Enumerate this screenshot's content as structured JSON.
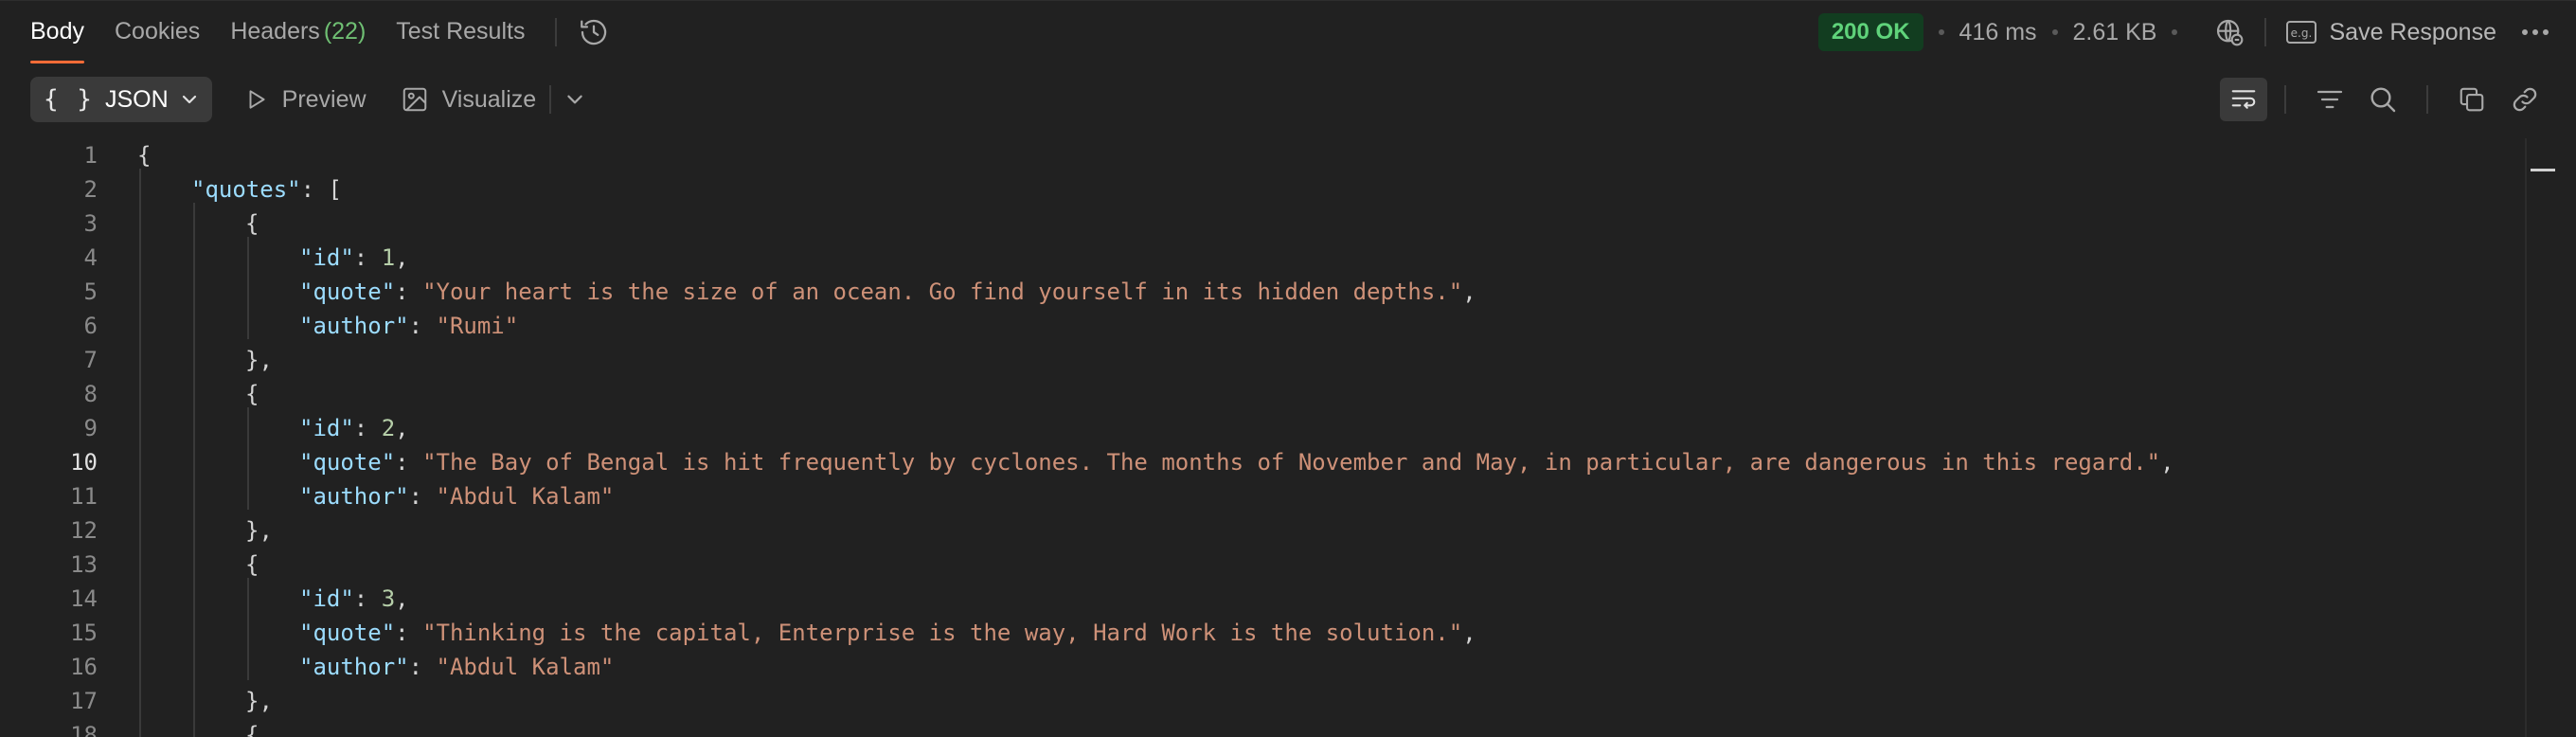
{
  "tabs": [
    {
      "label": "Body",
      "active": true
    },
    {
      "label": "Cookies"
    },
    {
      "label": "Headers",
      "count": "(22)"
    },
    {
      "label": "Test Results"
    }
  ],
  "response": {
    "status": "200 OK",
    "time": "416 ms",
    "size": "2.61 KB",
    "save_label": "Save Response"
  },
  "toolbar": {
    "format_label": "JSON",
    "format_icon": "{ }",
    "preview_label": "Preview",
    "visualize_label": "Visualize"
  },
  "editor": {
    "active_line": 10,
    "lines": [
      [
        [
          "p",
          "{"
        ]
      ],
      [
        [
          "k",
          "\"quotes\""
        ],
        [
          "p",
          ": ["
        ]
      ],
      [
        [
          "p",
          "{"
        ]
      ],
      [
        [
          "k",
          "\"id\""
        ],
        [
          "p",
          ": "
        ],
        [
          "n",
          "1"
        ],
        [
          "p",
          ","
        ]
      ],
      [
        [
          "k",
          "\"quote\""
        ],
        [
          "p",
          ": "
        ],
        [
          "s",
          "\"Your heart is the size of an ocean. Go find yourself in its hidden depths.\""
        ],
        [
          "p",
          ","
        ]
      ],
      [
        [
          "k",
          "\"author\""
        ],
        [
          "p",
          ": "
        ],
        [
          "s",
          "\"Rumi\""
        ]
      ],
      [
        [
          "p",
          "},"
        ]
      ],
      [
        [
          "p",
          "{"
        ]
      ],
      [
        [
          "k",
          "\"id\""
        ],
        [
          "p",
          ": "
        ],
        [
          "n",
          "2"
        ],
        [
          "p",
          ","
        ]
      ],
      [
        [
          "k",
          "\"quote\""
        ],
        [
          "p",
          ": "
        ],
        [
          "s",
          "\"The Bay of Bengal is hit frequently by cyclones. The months of November and May, in particular, are dangerous in this regard.\""
        ],
        [
          "p",
          ","
        ]
      ],
      [
        [
          "k",
          "\"author\""
        ],
        [
          "p",
          ": "
        ],
        [
          "s",
          "\"Abdul Kalam\""
        ]
      ],
      [
        [
          "p",
          "},"
        ]
      ],
      [
        [
          "p",
          "{"
        ]
      ],
      [
        [
          "k",
          "\"id\""
        ],
        [
          "p",
          ": "
        ],
        [
          "n",
          "3"
        ],
        [
          "p",
          ","
        ]
      ],
      [
        [
          "k",
          "\"quote\""
        ],
        [
          "p",
          ": "
        ],
        [
          "s",
          "\"Thinking is the capital, Enterprise is the way, Hard Work is the solution.\""
        ],
        [
          "p",
          ","
        ]
      ],
      [
        [
          "k",
          "\"author\""
        ],
        [
          "p",
          ": "
        ],
        [
          "s",
          "\"Abdul Kalam\""
        ]
      ],
      [
        [
          "p",
          "},"
        ]
      ],
      [
        [
          "p",
          "{"
        ]
      ]
    ]
  },
  "colors": {
    "background": "#212121",
    "accent": "#ff6c37",
    "status_bg": "#123d20",
    "status_text": "#5fd37a",
    "json_key": "#9cdcfe",
    "json_string": "#ce9178",
    "json_number": "#b5cea8"
  }
}
